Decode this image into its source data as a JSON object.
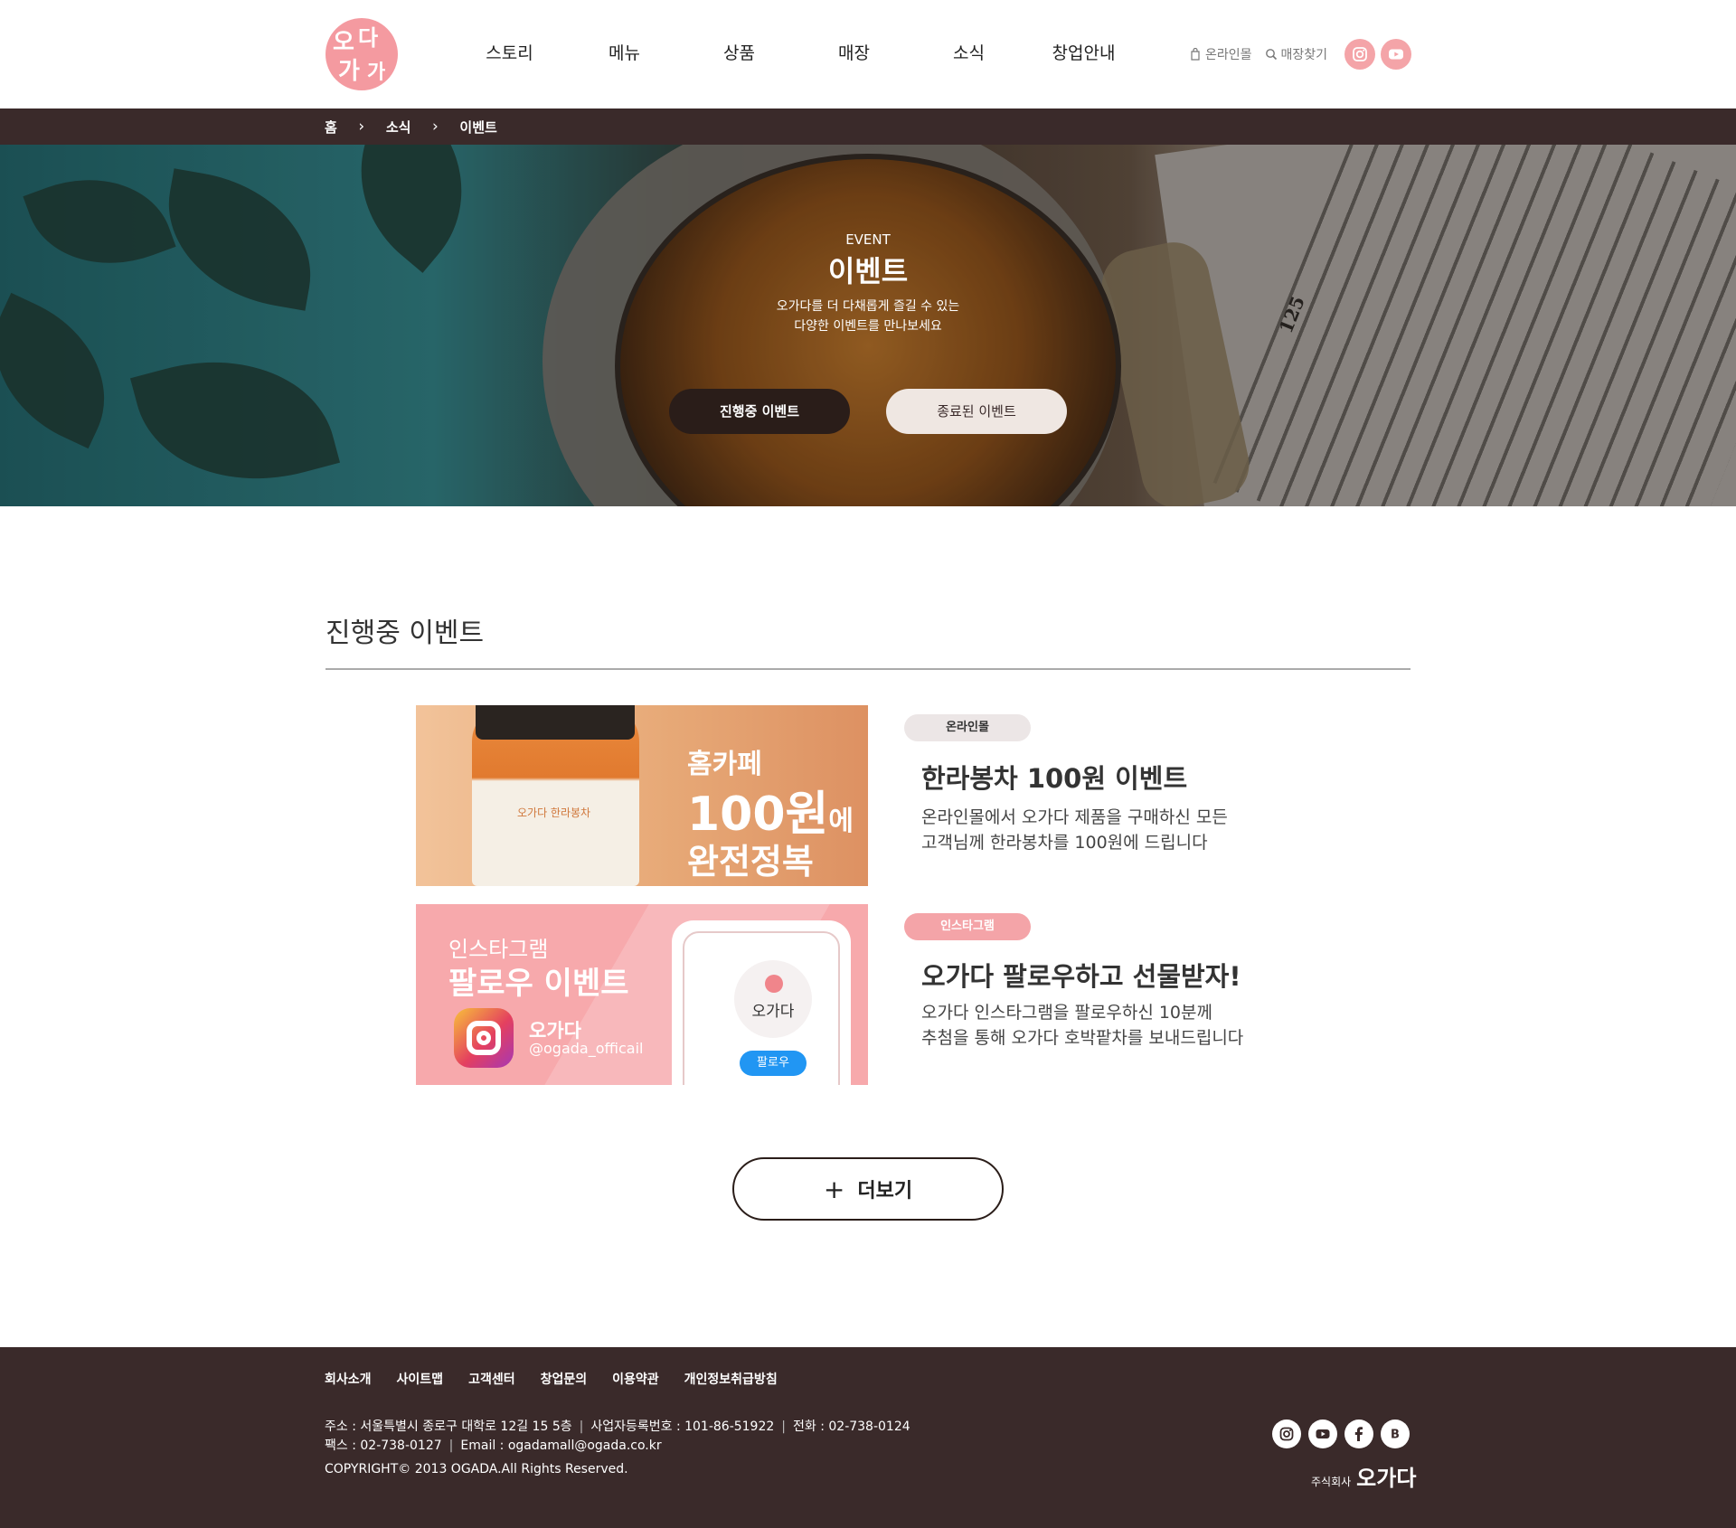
{
  "header": {
    "logo_text": "오다가 가",
    "nav": [
      "스토리",
      "메뉴",
      "상품",
      "매장",
      "소식",
      "창업안내"
    ],
    "util": {
      "online_mall": "온라인몰",
      "store_find": "매장찾기"
    },
    "sns": [
      "instagram-icon",
      "youtube-icon"
    ],
    "accent_color": "#f4a4a8"
  },
  "breadcrumb": {
    "home": "홈",
    "news": "소식",
    "current": "이벤트"
  },
  "hero": {
    "eyebrow": "EVENT",
    "title": "이벤트",
    "desc_line1": "오가다를 더 다채롭게 즐길 수 있는",
    "desc_line2": "다양한 이벤트를 만나보세요",
    "btn_ongoing": "진행중 이벤트",
    "btn_ended": "종료된 이벤트",
    "book_page": "125"
  },
  "section": {
    "title": "진행중 이벤트"
  },
  "events": [
    {
      "badge": "온라인몰",
      "title": "한라봉차 100원 이벤트",
      "desc_line1": "온라인몰에서 오가다 제품을 구매하신 모든",
      "desc_line2": "고객님께 한라봉차를 100원에 드립니다",
      "thumb": {
        "line1": "홈카페",
        "line2": "100원",
        "line2_suffix": "에",
        "line3": "완전정복",
        "jar_label": "오가다 한라봉차"
      }
    },
    {
      "badge": "인스타그램",
      "title": "오가다 팔로우하고 선물받자!",
      "desc_line1": "오가다 인스타그램을 팔로우하신 10분께",
      "desc_line2": "추첨을 통해 오가다 호박팥차를 보내드립니다",
      "thumb": {
        "line1": "인스타그램",
        "line2": "팔로우 이벤트",
        "name": "오가다",
        "handle": "@ogada_officail",
        "profile_name": "오가다",
        "follow": "팔로우"
      }
    }
  ],
  "more_button": {
    "plus": "+",
    "label": "더보기"
  },
  "footer": {
    "nav": [
      "회사소개",
      "사이트맵",
      "고객센터",
      "창업문의",
      "이용약관",
      "개인정보취급방침"
    ],
    "address": "주소 : 서울특별시 종로구 대학로 12길 15 5층",
    "biz_no": "사업자등록번호 : 101-86-51922",
    "tel": "전화 : 02-738-0124",
    "fax": "팩스 : 02-738-0127",
    "email": "Email : ogadamall@ogada.co.kr",
    "copyright": "COPYRIGHT© 2013 OGADA.All Rights Reserved.",
    "corp_prefix": "주식회사",
    "corp_name": "오가다",
    "sns": [
      "instagram-icon",
      "youtube-icon",
      "facebook-icon",
      "blog-icon"
    ]
  }
}
